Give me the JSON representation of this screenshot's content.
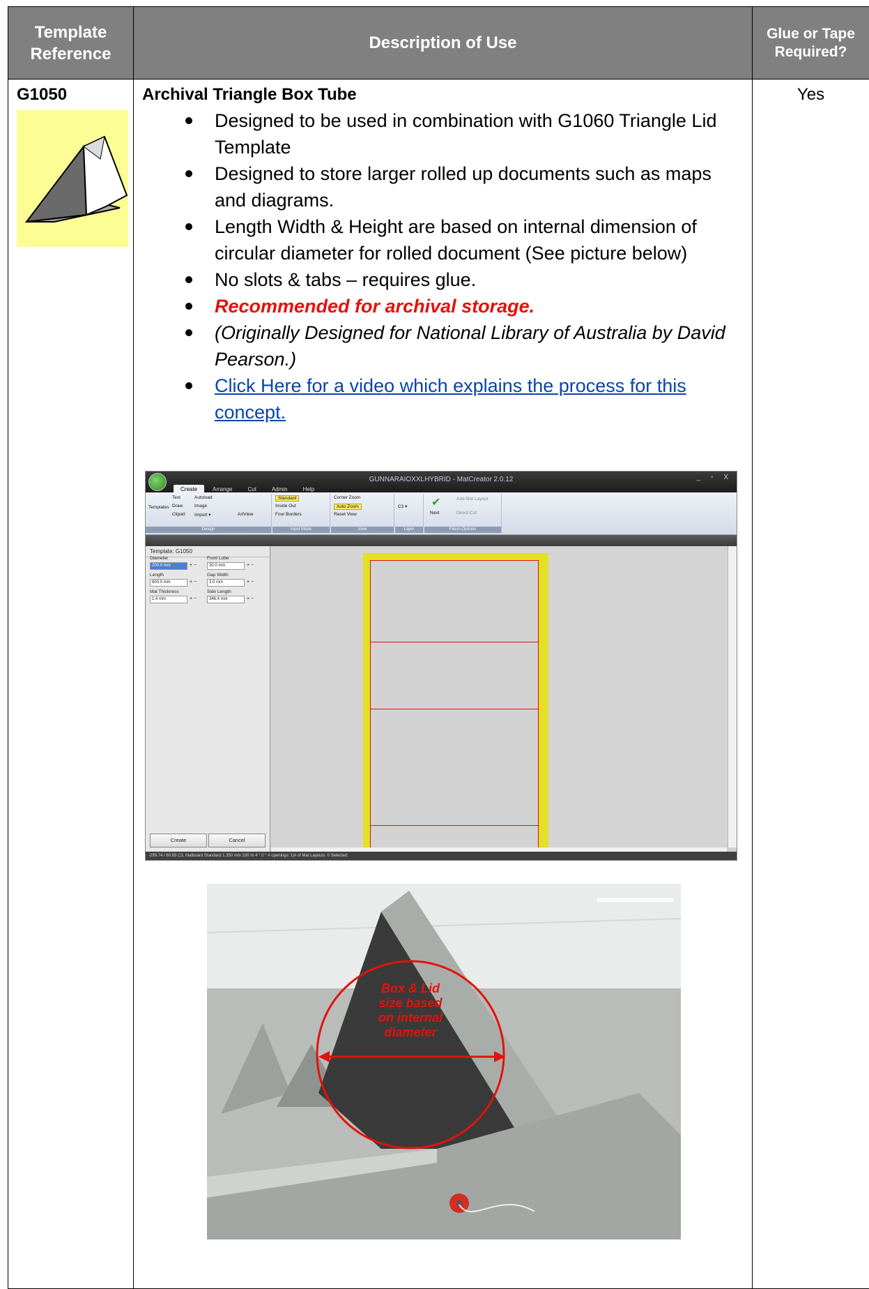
{
  "header": {
    "col1": "Template Reference",
    "col2": "Description of Use",
    "col3": "Glue or Tape Required?"
  },
  "row": {
    "reference": "G1050",
    "title": "Archival Triangle Box Tube",
    "bullets": [
      "Designed to be used in combination with G1060 Triangle Lid Template",
      "Designed to store larger rolled up documents such as maps and diagrams.",
      "Length Width & Height are based on internal dimension of circular diameter for rolled document (See picture below)",
      "No slots & tabs – requires glue.",
      "Recommended for archival storage.",
      "(Originally Designed for National Library of Australia by David Pearson.)",
      "Click Here for a video which explains the process for this concept."
    ],
    "glue_required": "Yes"
  },
  "screenshot": {
    "window_title": "GUNNARAIOXXLHYBRID - MatCreator 2.0.12",
    "window_controls": "_ ▫ X",
    "tabs": [
      "Create",
      "Arrange",
      "Cut",
      "Admin",
      "Help"
    ],
    "ribbon": {
      "templates": "Templates",
      "text": "Text",
      "autoload": "Autoload",
      "draw": "Draw",
      "image": "Image",
      "clipart": "Clipart",
      "import": "Import ▾",
      "artview": "ArtView",
      "standard": "Standard",
      "inside_out": "Inside Out",
      "four_borders": "Four Borders",
      "corner_zoom": "Corner Zoom",
      "auto_zoom": "Auto Zoom",
      "reset_view": "Reset View",
      "layer": "C3 ▾",
      "next": "Next",
      "add_mat_layout": "Add Mat Layout",
      "direct_cut": "Direct Cut",
      "group_design": "Design",
      "group_input": "Input Mode",
      "group_view": "View",
      "group_layer": "Layer",
      "group_finish": "Finish Options"
    },
    "template_label": "Template: G1050",
    "fields": {
      "diameter_label": "Diameter",
      "diameter_value": "200.0 mm",
      "front_lobe_label": "Front Lobe",
      "front_lobe_value": "30.0 mm",
      "length_label": "Length",
      "length_value": "800.0 mm",
      "gap_width_label": "Gap Width",
      "gap_width_value": "3.0 mm",
      "mat_thickness_label": "Mat Thickness",
      "mat_thickness_value": "1.4 mm",
      "side_length_label": "Side Length",
      "side_length_value": "346.4 mm",
      "plus_minus": "+ −"
    },
    "create_button": "Create",
    "cancel_button": "Cancel",
    "status": "-299.74 / 60.93    C3, Matboard Standard   1.350 mm   100 %   4 °   0 °   # openings: 1|# of Mat Layouts: 0   Selected:"
  },
  "photo": {
    "annotation": [
      "Box & Lid",
      "size based",
      "on internal",
      "diameter"
    ],
    "annotation_color": "#e3120b"
  },
  "colors": {
    "header_bg": "#808080",
    "thumbnail_bg": "#fdfd96",
    "recommended_text": "#e3120b",
    "link": "#0645ad",
    "mat_yellow": "#e3e025",
    "cut_line_red": "#dd1111"
  }
}
